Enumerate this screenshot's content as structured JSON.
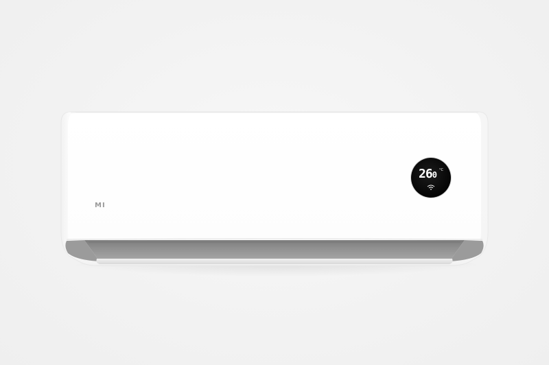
{
  "product": {
    "logo_text": "MI",
    "display": {
      "temperature": "26",
      "decimal": "0",
      "unit": "°C",
      "status_icon": "wifi-icon"
    }
  },
  "colors": {
    "background": "#f2f2f2",
    "body": "#ffffff",
    "vent": "#8e8e8e",
    "display_bg": "#000000",
    "display_text": "#ffffff",
    "logo": "#9a9a9a"
  }
}
